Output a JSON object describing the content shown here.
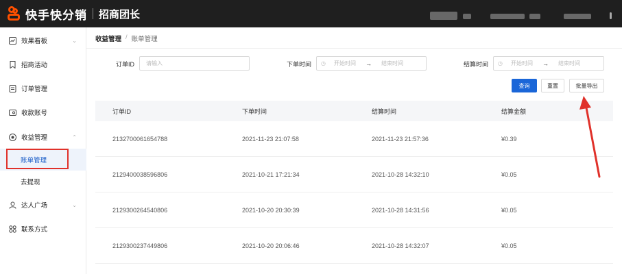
{
  "header": {
    "brand": "快手快分销",
    "sub": "招商团长"
  },
  "sidebar": {
    "items": [
      {
        "label": "效果看板",
        "icon": "dashboard-icon",
        "chevron": "⌄"
      },
      {
        "label": "招商活动",
        "icon": "bookmark-icon",
        "chevron": ""
      },
      {
        "label": "订单管理",
        "icon": "document-icon",
        "chevron": ""
      },
      {
        "label": "收款账号",
        "icon": "card-icon",
        "chevron": ""
      },
      {
        "label": "收益管理",
        "icon": "coin-icon",
        "chevron": "⌃"
      },
      {
        "label": "达人广场",
        "icon": "user-icon",
        "chevron": "⌄"
      },
      {
        "label": "联系方式",
        "icon": "grid-icon",
        "chevron": ""
      }
    ],
    "subitems": [
      {
        "label": "账单管理",
        "active": true
      },
      {
        "label": "去提现",
        "active": false
      }
    ]
  },
  "breadcrumb": {
    "parent": "收益管理",
    "separator": "/",
    "current": "账单管理"
  },
  "filters": {
    "order_id_label": "订单ID",
    "order_id_placeholder": "请输入",
    "order_time_label": "下单时间",
    "settle_time_label": "结算时间",
    "start_placeholder": "开始时间",
    "end_placeholder": "结束时间",
    "range_arrow": "→"
  },
  "buttons": {
    "query": "查询",
    "reset": "重置",
    "export": "批量导出"
  },
  "table": {
    "columns": [
      "订单ID",
      "下单时间",
      "结算时间",
      "结算金额"
    ],
    "rows": [
      [
        "2132700061654788",
        "2021-11-23 21:07:58",
        "2021-11-23 21:57:36",
        "¥0.39"
      ],
      [
        "2129400038596806",
        "2021-10-21 17:21:34",
        "2021-10-28 14:32:10",
        "¥0.05"
      ],
      [
        "2129300264540806",
        "2021-10-20 20:30:39",
        "2021-10-28 14:31:56",
        "¥0.05"
      ],
      [
        "2129300237449806",
        "2021-10-20 20:06:46",
        "2021-10-28 14:32:07",
        "¥0.05"
      ]
    ]
  },
  "colors": {
    "brand_orange": "#ff5000",
    "primary_blue": "#1a66d8",
    "annotation_red": "#e0312a"
  }
}
